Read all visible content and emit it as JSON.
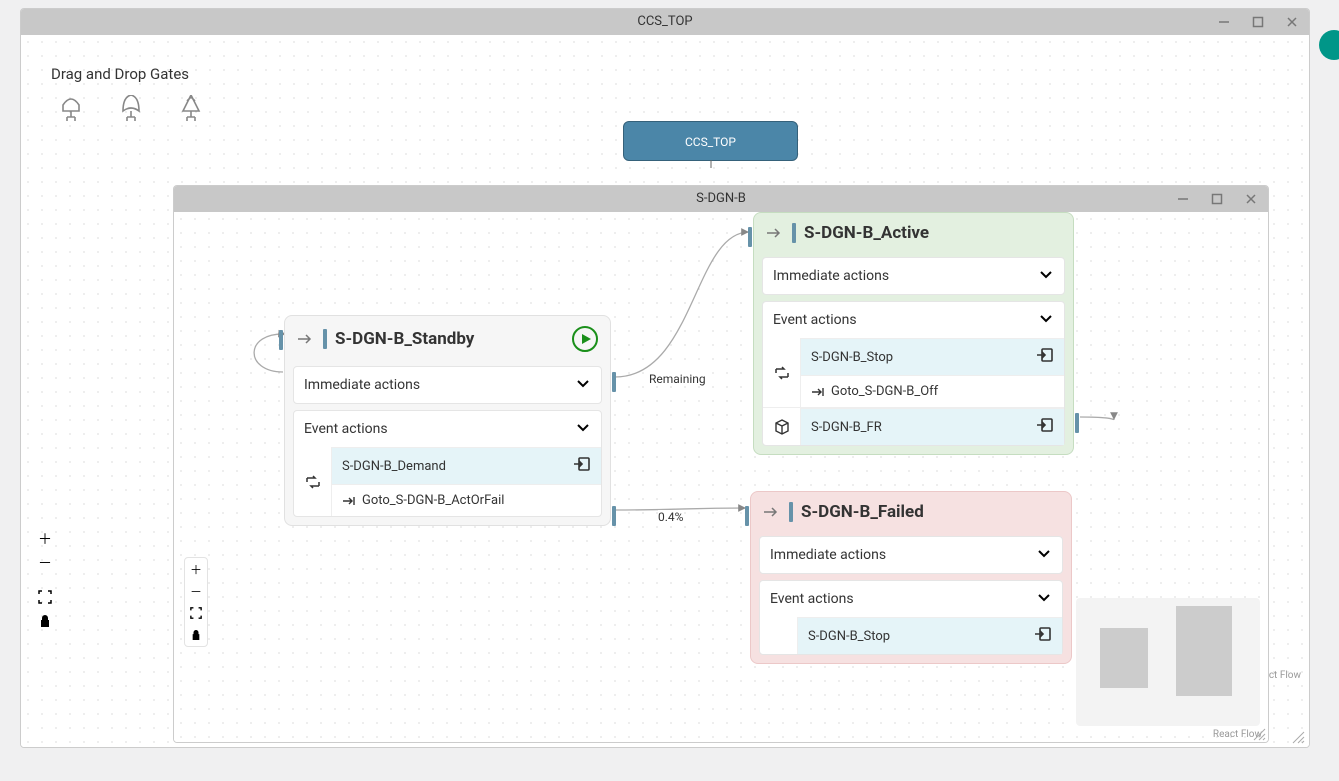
{
  "outer_window": {
    "title": "CCS_TOP"
  },
  "palette": {
    "title": "Drag and Drop Gates"
  },
  "root_node": {
    "label": "CCS_TOP"
  },
  "inner_window": {
    "title": "S-DGN-B",
    "attribution": "React Flow"
  },
  "outer_attribution": "React Flow",
  "sections": {
    "immediate": "Immediate actions",
    "event": "Event actions"
  },
  "edges": {
    "remaining": "Remaining",
    "percent": "0.4%"
  },
  "states": {
    "standby": {
      "title": "S-DGN-B_Standby",
      "event_items": [
        {
          "label": "S-DGN-B_Demand",
          "sub_label": "Goto_S-DGN-B_ActOrFail"
        }
      ]
    },
    "active": {
      "title": "S-DGN-B_Active",
      "event_items": [
        {
          "label": "S-DGN-B_Stop",
          "sub_label": "Goto_S-DGN-B_Off"
        },
        {
          "label": "S-DGN-B_FR"
        }
      ]
    },
    "failed": {
      "title": "S-DGN-B_Failed",
      "event_items": [
        {
          "label": "S-DGN-B_Stop"
        }
      ]
    }
  }
}
